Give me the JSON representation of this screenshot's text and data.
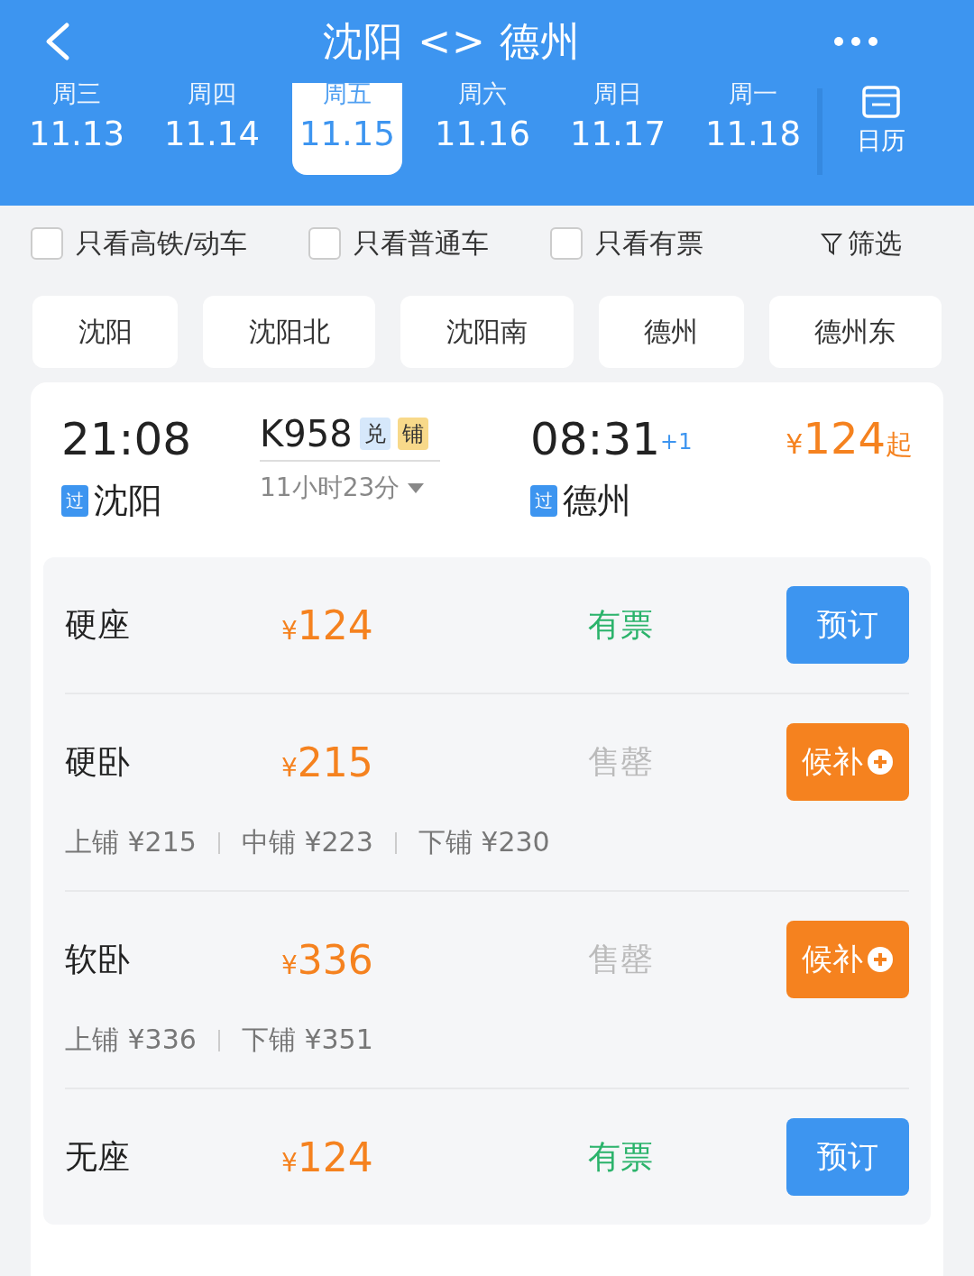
{
  "header": {
    "title": "沈阳 <> 德州"
  },
  "dates": [
    {
      "weekday": "周三",
      "date": "11.13",
      "selected": false
    },
    {
      "weekday": "周四",
      "date": "11.14",
      "selected": false
    },
    {
      "weekday": "周五",
      "date": "11.15",
      "selected": true
    },
    {
      "weekday": "周六",
      "date": "11.16",
      "selected": false
    },
    {
      "weekday": "周日",
      "date": "11.17",
      "selected": false
    },
    {
      "weekday": "周一",
      "date": "11.18",
      "selected": false
    }
  ],
  "calendar": {
    "label": "日历"
  },
  "filters": [
    {
      "label": "只看高铁/动车",
      "checked": false
    },
    {
      "label": "只看普通车",
      "checked": false
    },
    {
      "label": "只看有票",
      "checked": false
    }
  ],
  "filter_button": {
    "label": "筛选"
  },
  "stations": [
    "沈阳",
    "沈阳北",
    "沈阳南",
    "德州",
    "德州东"
  ],
  "train": {
    "depart_time": "21:08",
    "depart_tag": "过",
    "depart_station": "沈阳",
    "number": "K958",
    "badges": [
      {
        "text": "兑",
        "color": "#d6e8fb"
      },
      {
        "text": "铺",
        "color": "#f8d98a"
      }
    ],
    "duration": "11小时23分",
    "arrive_time": "08:31",
    "day_offset": "+1",
    "arrive_tag": "过",
    "arrive_station": "德州",
    "price_symbol": "¥",
    "price": "124",
    "price_suffix": "起"
  },
  "seats": [
    {
      "name": "硬座",
      "price": "124",
      "status": "有票",
      "available": true,
      "kind": "book",
      "action": "预订"
    },
    {
      "name": "硬卧",
      "price": "215",
      "status": "售罄",
      "available": false,
      "kind": "waitlist",
      "action": "候补",
      "berths": [
        "上铺 ¥215",
        "中铺 ¥223",
        "下铺 ¥230"
      ]
    },
    {
      "name": "软卧",
      "price": "336",
      "status": "售罄",
      "available": false,
      "kind": "waitlist",
      "action": "候补",
      "berths": [
        "上铺 ¥336",
        "下铺 ¥351"
      ]
    },
    {
      "name": "无座",
      "price": "124",
      "status": "有票",
      "available": true,
      "kind": "book",
      "action": "预订"
    }
  ]
}
